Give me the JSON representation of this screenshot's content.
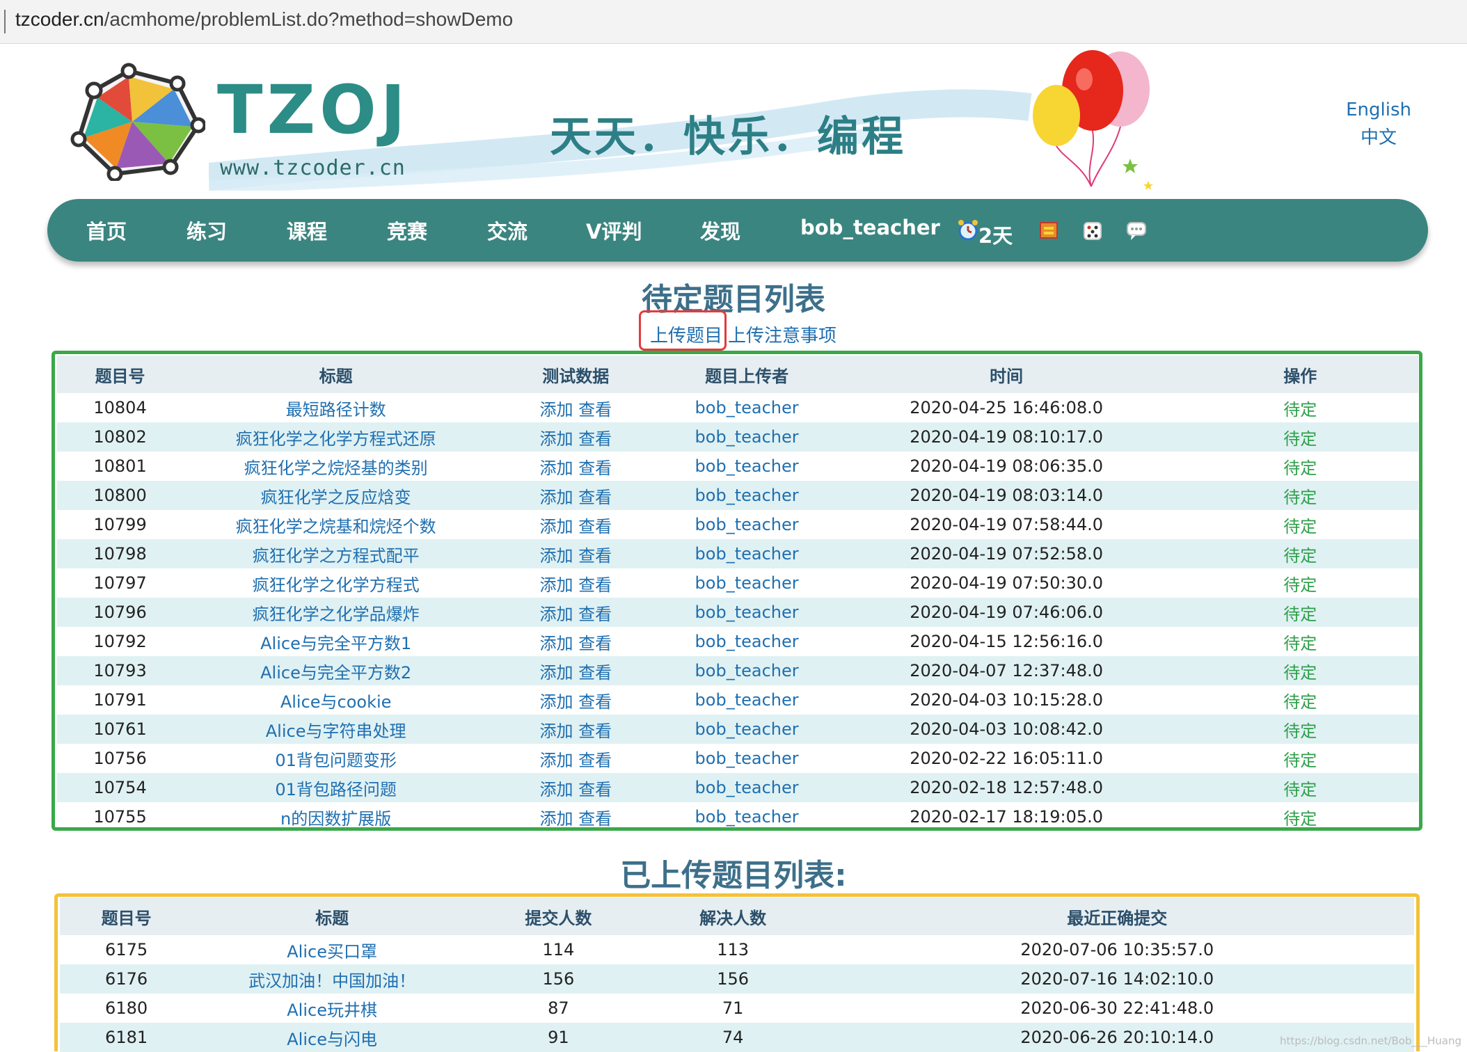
{
  "browser": {
    "url_host": "tzcoder.cn",
    "url_path": "/acmhome/problemList.do?method=showDemo"
  },
  "banner": {
    "brand": "TZOJ",
    "site_url": "www.tzcoder.cn",
    "slogan": "天天．快乐．编程",
    "lang_english": "English",
    "lang_chinese": "中文"
  },
  "nav": {
    "items": [
      "首页",
      "练习",
      "课程",
      "竞赛",
      "交流",
      "V评判",
      "发现",
      "bob_teacher"
    ],
    "days": "2天",
    "color": "#3b8580"
  },
  "pending": {
    "title": "待定题目列表",
    "upload_link": "上传题目",
    "notes_link": "上传注意事项",
    "headers": [
      "题目号",
      "标题",
      "测试数据",
      "题目上传者",
      "时间",
      "操作"
    ],
    "add_label": "添加",
    "view_label": "查看",
    "rows": [
      {
        "id": "10804",
        "title": "最短路径计数",
        "uploader": "bob_teacher",
        "time": "2020-04-25 16:46:08.0",
        "op": "待定"
      },
      {
        "id": "10802",
        "title": "疯狂化学之化学方程式还原",
        "uploader": "bob_teacher",
        "time": "2020-04-19 08:10:17.0",
        "op": "待定"
      },
      {
        "id": "10801",
        "title": "疯狂化学之烷烃基的类别",
        "uploader": "bob_teacher",
        "time": "2020-04-19 08:06:35.0",
        "op": "待定"
      },
      {
        "id": "10800",
        "title": "疯狂化学之反应焓变",
        "uploader": "bob_teacher",
        "time": "2020-04-19 08:03:14.0",
        "op": "待定"
      },
      {
        "id": "10799",
        "title": "疯狂化学之烷基和烷烃个数",
        "uploader": "bob_teacher",
        "time": "2020-04-19 07:58:44.0",
        "op": "待定"
      },
      {
        "id": "10798",
        "title": "疯狂化学之方程式配平",
        "uploader": "bob_teacher",
        "time": "2020-04-19 07:52:58.0",
        "op": "待定"
      },
      {
        "id": "10797",
        "title": "疯狂化学之化学方程式",
        "uploader": "bob_teacher",
        "time": "2020-04-19 07:50:30.0",
        "op": "待定"
      },
      {
        "id": "10796",
        "title": "疯狂化学之化学品爆炸",
        "uploader": "bob_teacher",
        "time": "2020-04-19 07:46:06.0",
        "op": "待定"
      },
      {
        "id": "10792",
        "title": "Alice与完全平方数1",
        "uploader": "bob_teacher",
        "time": "2020-04-15 12:56:16.0",
        "op": "待定"
      },
      {
        "id": "10793",
        "title": "Alice与完全平方数2",
        "uploader": "bob_teacher",
        "time": "2020-04-07 12:37:48.0",
        "op": "待定"
      },
      {
        "id": "10791",
        "title": "Alice与cookie",
        "uploader": "bob_teacher",
        "time": "2020-04-03 10:15:28.0",
        "op": "待定"
      },
      {
        "id": "10761",
        "title": "Alice与字符串处理",
        "uploader": "bob_teacher",
        "time": "2020-04-03 10:08:42.0",
        "op": "待定"
      },
      {
        "id": "10756",
        "title": "01背包问题变形",
        "uploader": "bob_teacher",
        "time": "2020-02-22 16:05:11.0",
        "op": "待定"
      },
      {
        "id": "10754",
        "title": "01背包路径问题",
        "uploader": "bob_teacher",
        "time": "2020-02-18 12:57:48.0",
        "op": "待定"
      },
      {
        "id": "10755",
        "title": "n的因数扩展版",
        "uploader": "bob_teacher",
        "time": "2020-02-17 18:19:05.0",
        "op": "待定"
      }
    ]
  },
  "uploaded": {
    "title": "已上传题目列表:",
    "headers": [
      "题目号",
      "标题",
      "提交人数",
      "解决人数",
      "最近正确提交"
    ],
    "rows": [
      {
        "id": "6175",
        "title": "Alice买口罩",
        "submits": "114",
        "solved": "113",
        "last": "2020-07-06 10:35:57.0"
      },
      {
        "id": "6176",
        "title": "武汉加油！中国加油！",
        "submits": "156",
        "solved": "156",
        "last": "2020-07-16 14:02:10.0"
      },
      {
        "id": "6180",
        "title": "Alice玩井棋",
        "submits": "87",
        "solved": "71",
        "last": "2020-06-30 22:41:48.0"
      },
      {
        "id": "6181",
        "title": "Alice与闪电",
        "submits": "91",
        "solved": "74",
        "last": "2020-06-26 20:10:14.0"
      }
    ]
  },
  "watermark": "https://blog.csdn.net/Bob___Huang"
}
